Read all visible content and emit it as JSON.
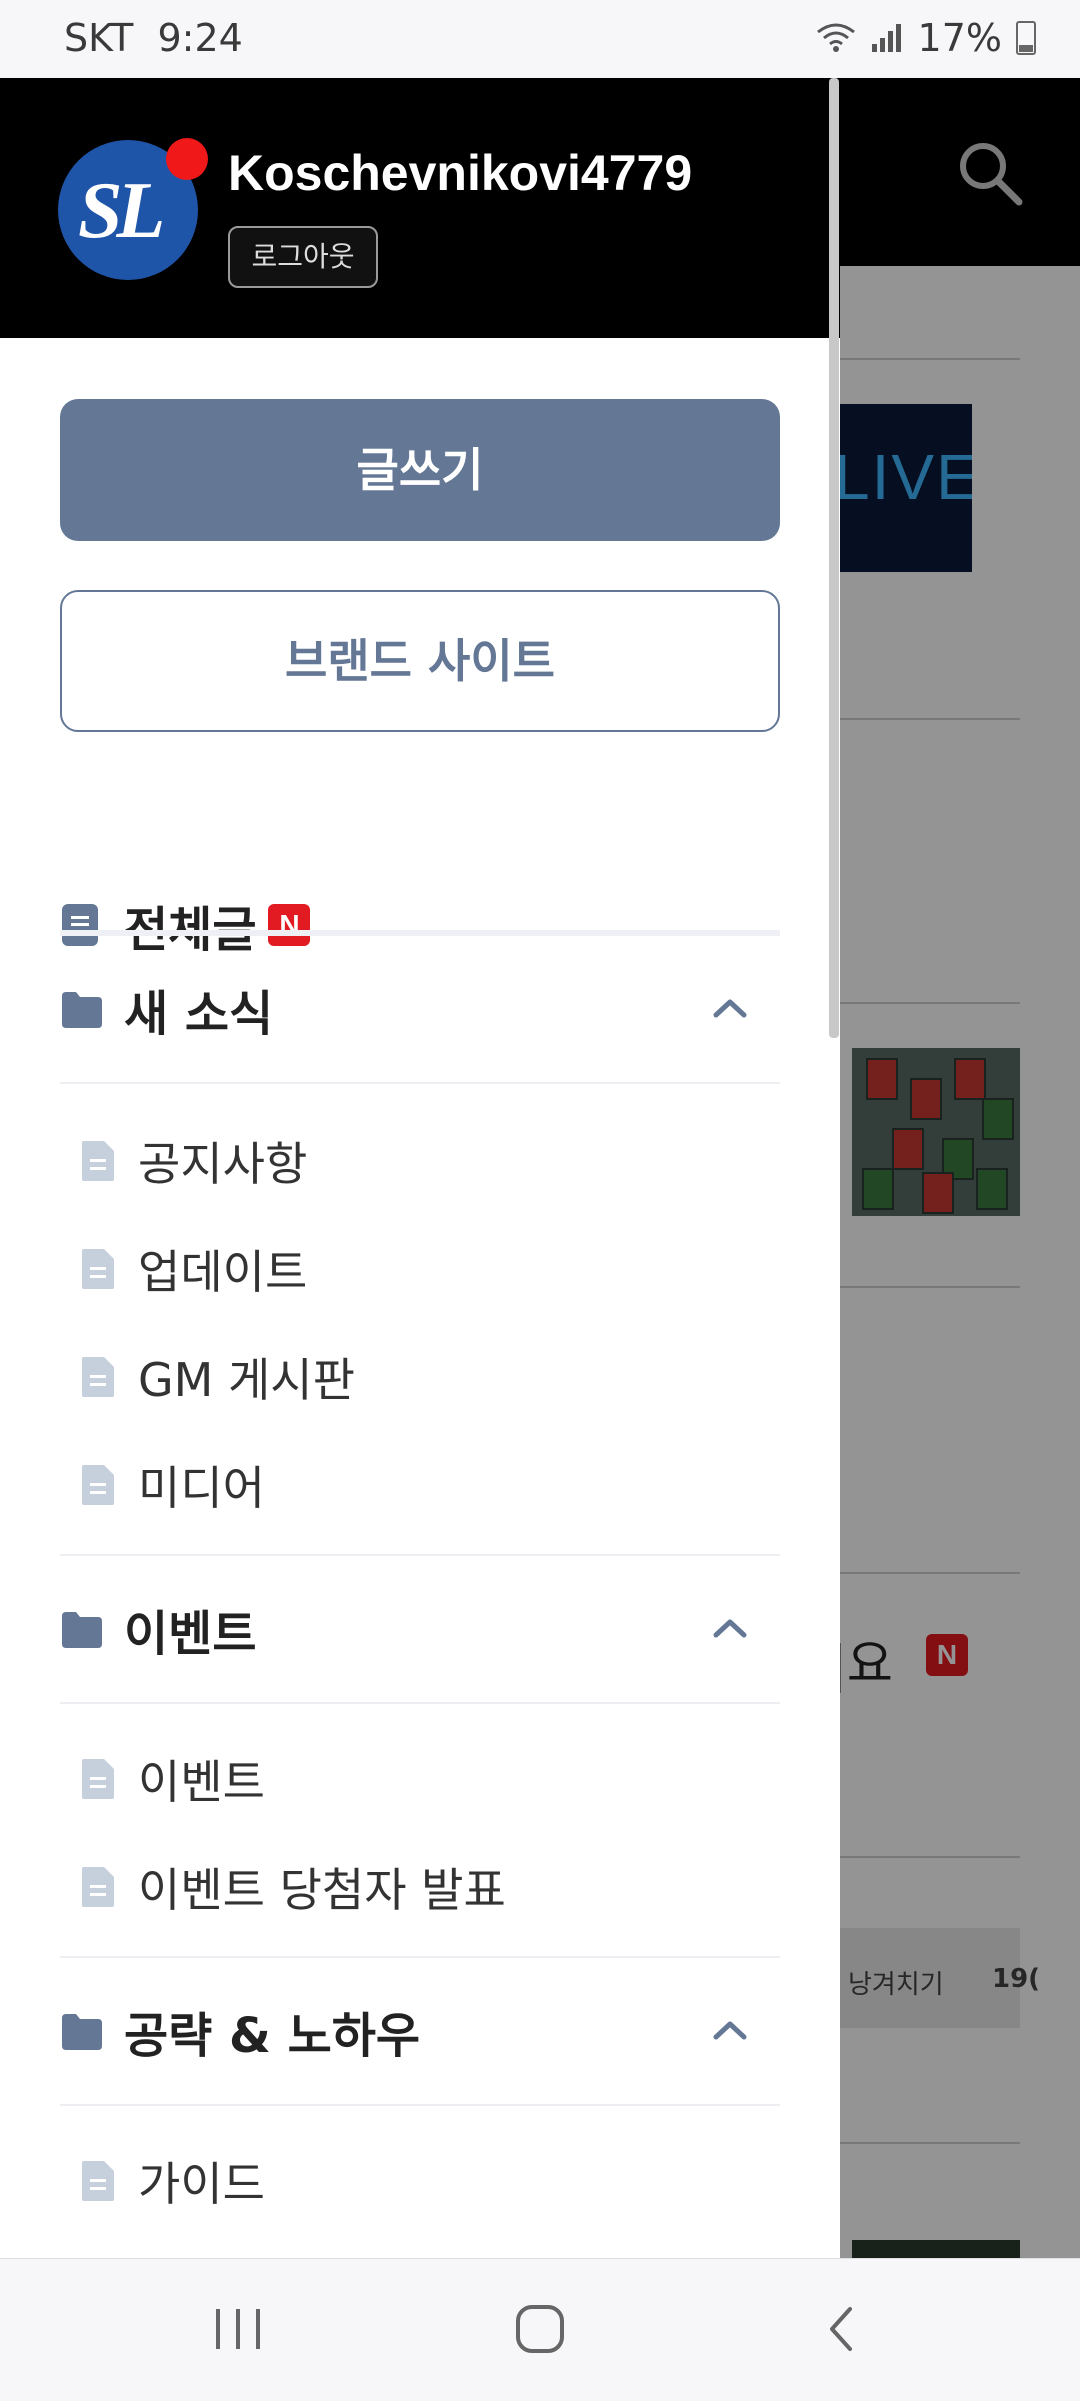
{
  "status": {
    "carrier": "SKT",
    "time": "9:24",
    "battery": "17%"
  },
  "drawer": {
    "username": "Koschevnikovi4779",
    "avatar_text": "SL",
    "logout_label": "로그아웃",
    "write_label": "글쓰기",
    "brand_label": "브랜드 사이트",
    "all_posts_label": "전체글",
    "new_badge": "N",
    "sections": [
      {
        "title": "새 소식",
        "items": [
          "공지사항",
          "업데이트",
          "GM 게시판",
          "미디어"
        ]
      },
      {
        "title": "이벤트",
        "items": [
          "이벤트",
          "이벤트 당첨자 발표"
        ]
      },
      {
        "title": "공략 & 노하우",
        "items": [
          "가이드"
        ]
      }
    ]
  },
  "background": {
    "live_text": "LIVE",
    "partial_text": "|요",
    "new_badge": "N",
    "tag_1": "낭겨치기",
    "tag_2": "19("
  },
  "colors": {
    "accent": "#647896",
    "badge": "#e21b22",
    "header": "#000000"
  }
}
